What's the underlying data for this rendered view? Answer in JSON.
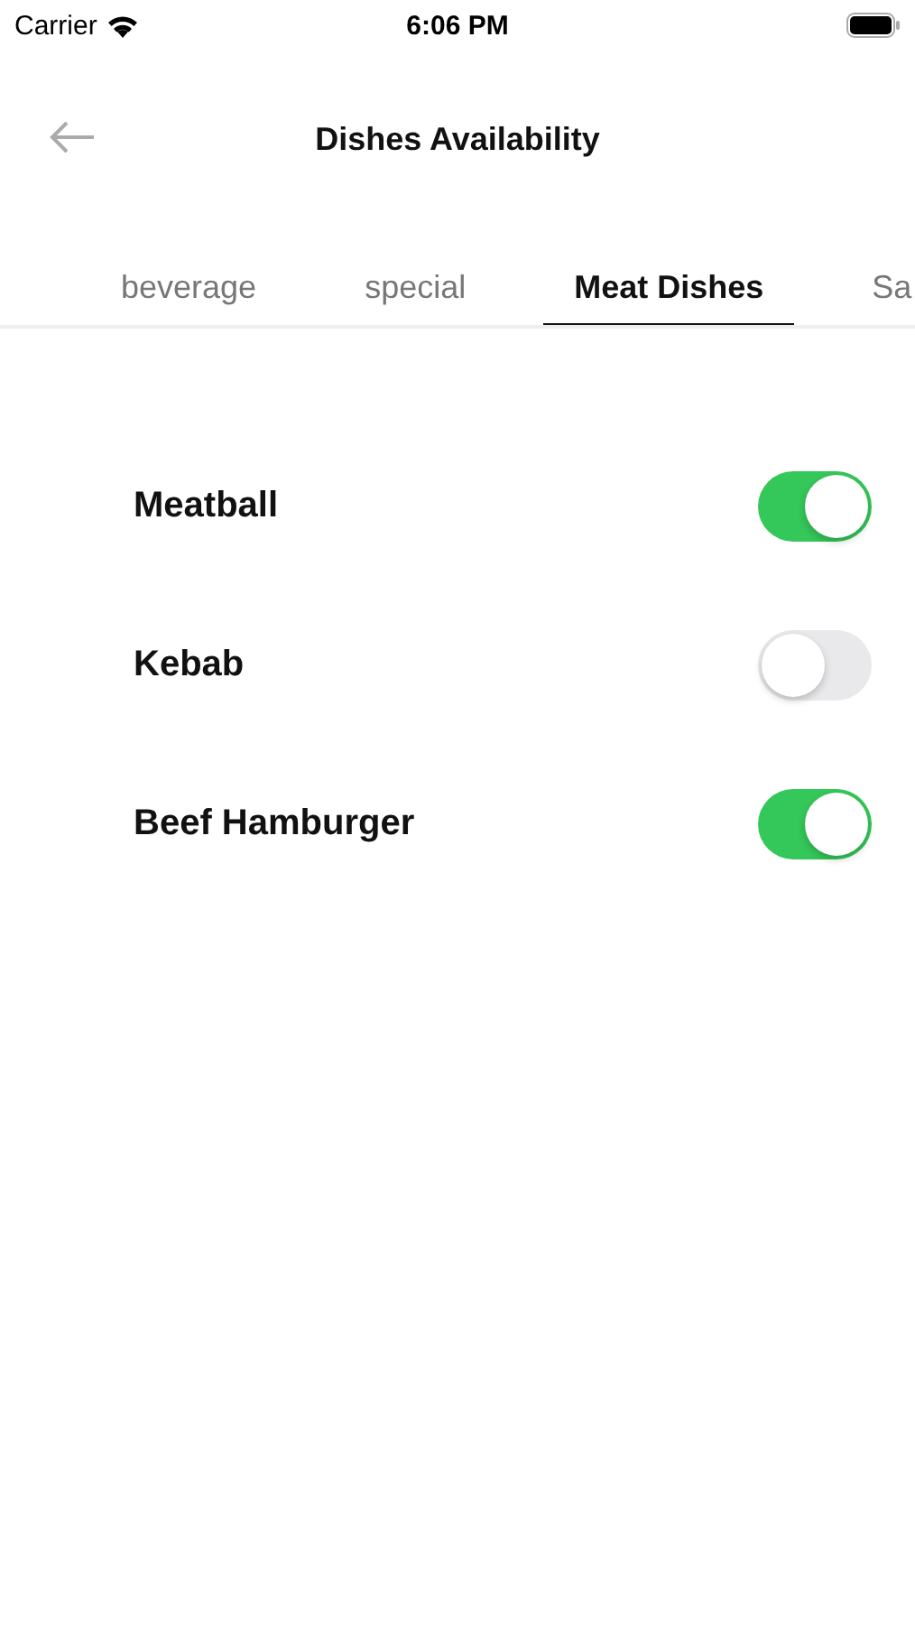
{
  "status_bar": {
    "carrier": "Carrier",
    "time": "6:06 PM"
  },
  "header": {
    "title": "Dishes Availability"
  },
  "tabs": [
    {
      "label": "beverage",
      "selected": false
    },
    {
      "label": "special",
      "selected": false
    },
    {
      "label": "Meat Dishes",
      "selected": true
    },
    {
      "label": "Sa",
      "selected": false
    }
  ],
  "dishes": [
    {
      "name": "Meatball",
      "on": true
    },
    {
      "name": "Kebab",
      "on": false
    },
    {
      "name": "Beef Hamburger",
      "on": true
    }
  ]
}
